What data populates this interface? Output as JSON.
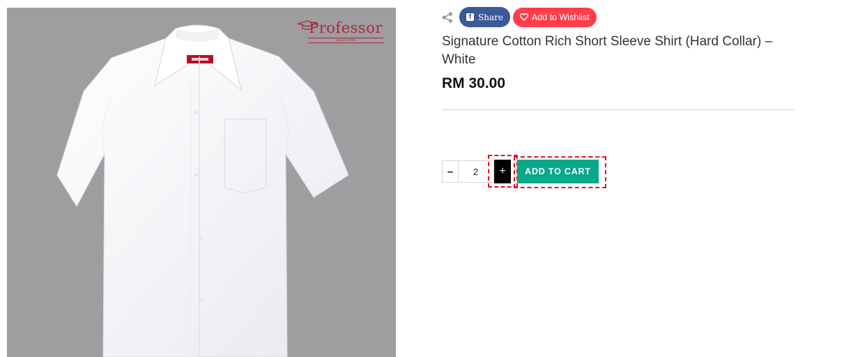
{
  "product": {
    "brand_name": "Professor",
    "brand_tagline": "since 1985",
    "title": "Signature Cotton Rich Short Sleeve Shirt (Hard Collar) – White",
    "price": "RM 30.00"
  },
  "share": {
    "share_icon": "share-icon",
    "facebook_icon": "facebook-icon",
    "facebook_label": "Share",
    "wishlist_icon": "heart-icon",
    "wishlist_label": "Add to Wishlist"
  },
  "quantity": {
    "minus_label": "–",
    "value": "2",
    "plus_label": "+"
  },
  "cart": {
    "add_label": "ADD TO CART"
  },
  "colors": {
    "facebook_blue": "#3b5998",
    "wishlist_red": "#ff3d4a",
    "cart_green": "#0aa88a",
    "highlight_red": "#e0141c"
  }
}
